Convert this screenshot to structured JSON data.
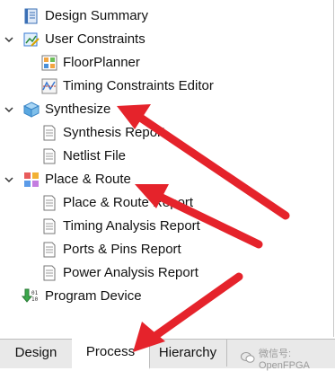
{
  "tree": {
    "items": [
      {
        "label": "Design Summary",
        "icon": "document-summary-icon"
      },
      {
        "label": "User Constraints",
        "icon": "constraints-icon"
      },
      {
        "label": "FloorPlanner",
        "icon": "floorplanner-icon"
      },
      {
        "label": "Timing Constraints Editor",
        "icon": "timing-editor-icon"
      },
      {
        "label": "Synthesize",
        "icon": "synthesize-cube-icon"
      },
      {
        "label": "Synthesis Report",
        "icon": "report-icon"
      },
      {
        "label": "Netlist File",
        "icon": "report-icon"
      },
      {
        "label": "Place & Route",
        "icon": "place-route-icon"
      },
      {
        "label": "Place & Route Report",
        "icon": "report-icon"
      },
      {
        "label": "Timing Analysis Report",
        "icon": "report-icon"
      },
      {
        "label": "Ports & Pins Report",
        "icon": "report-icon"
      },
      {
        "label": "Power Analysis Report",
        "icon": "report-icon"
      },
      {
        "label": "Program Device",
        "icon": "program-device-icon"
      }
    ]
  },
  "tabs": [
    {
      "label": "Design"
    },
    {
      "label": "Process",
      "active": true
    },
    {
      "label": "Hierarchy"
    }
  ],
  "watermark": {
    "text": "微信号: OpenFPGA"
  },
  "colors": {
    "arrow": "#e5232b",
    "tab_bg": "#e9e9e9"
  }
}
